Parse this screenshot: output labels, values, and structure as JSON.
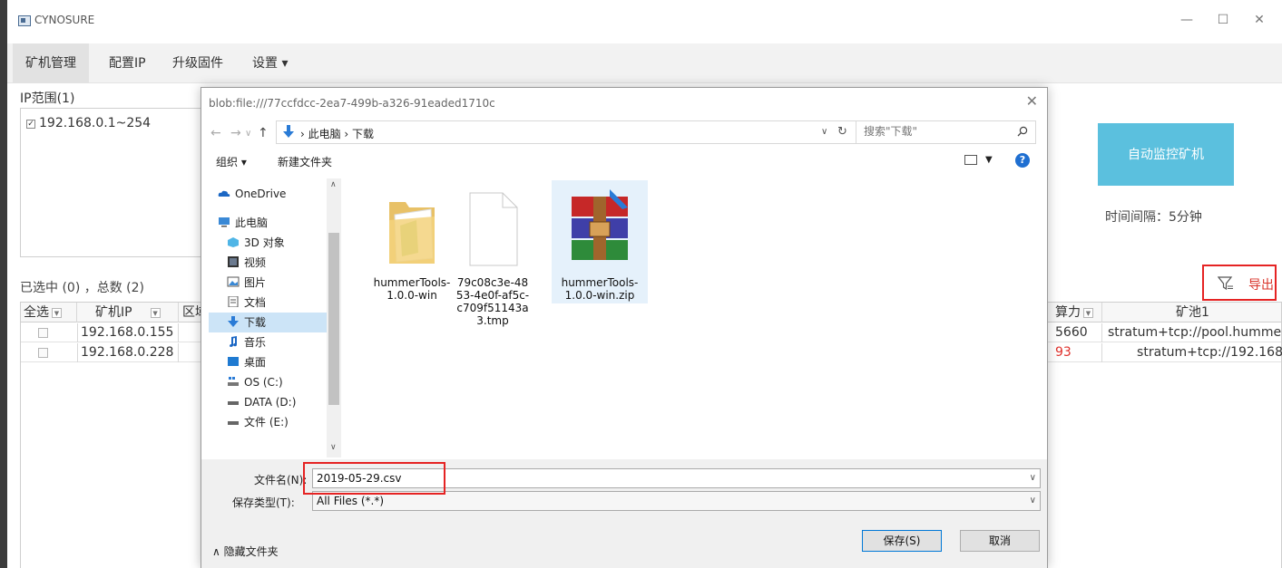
{
  "app": {
    "title": "CYNOSURE",
    "minimize": "—",
    "maximize": "☐",
    "close": "✕"
  },
  "menu": {
    "items": [
      "矿机管理",
      "配置IP",
      "升级固件",
      "设置 ▾"
    ]
  },
  "ip_panel": {
    "label": "IP范围(1)",
    "range": "192.168.0.1~254"
  },
  "selection_info": "已选中 (0) ，总数 (2)",
  "table": {
    "headers": [
      "全选",
      "矿机IP",
      "区域",
      "算力",
      "矿池1"
    ],
    "rows": [
      {
        "ip": "192.168.0.155",
        "hashrate": "5660",
        "pool": "stratum+tcp://pool.humme"
      },
      {
        "ip": "192.168.0.228",
        "hashrate": "93",
        "pool": "stratum+tcp://192.168"
      }
    ]
  },
  "right": {
    "auto_monitor": "自动监控矿机",
    "interval": "时间间隔：5分钟",
    "export": "导出"
  },
  "dialog": {
    "title": "blob:file:///77ccfdcc-2ea7-499b-a326-91eaded1710c",
    "close": "✕",
    "path": "›  此电脑  ›  下载",
    "search_placeholder": "搜索\"下载\"",
    "organize": "组织 ▾",
    "new_folder": "新建文件夹",
    "nav": [
      "OneDrive",
      "此电脑",
      "3D 对象",
      "视频",
      "图片",
      "文档",
      "下载",
      "音乐",
      "桌面",
      "OS (C:)",
      "DATA (D:)",
      "文件 (E:)"
    ],
    "files": [
      {
        "name": "hummerTools-1.0.0-win"
      },
      {
        "name": "79c08c3e-4853-4e0f-af5c-c709f51143a3.tmp"
      },
      {
        "name": "hummerTools-1.0.0-win.zip"
      }
    ],
    "filename_label": "文件名(N):",
    "filename_value": "2019-05-29.csv",
    "filetype_label": "保存类型(T):",
    "filetype_value": "All Files (*.*)",
    "hide_folders": "∧  隐藏文件夹",
    "save": "保存(S)",
    "cancel": "取消"
  }
}
